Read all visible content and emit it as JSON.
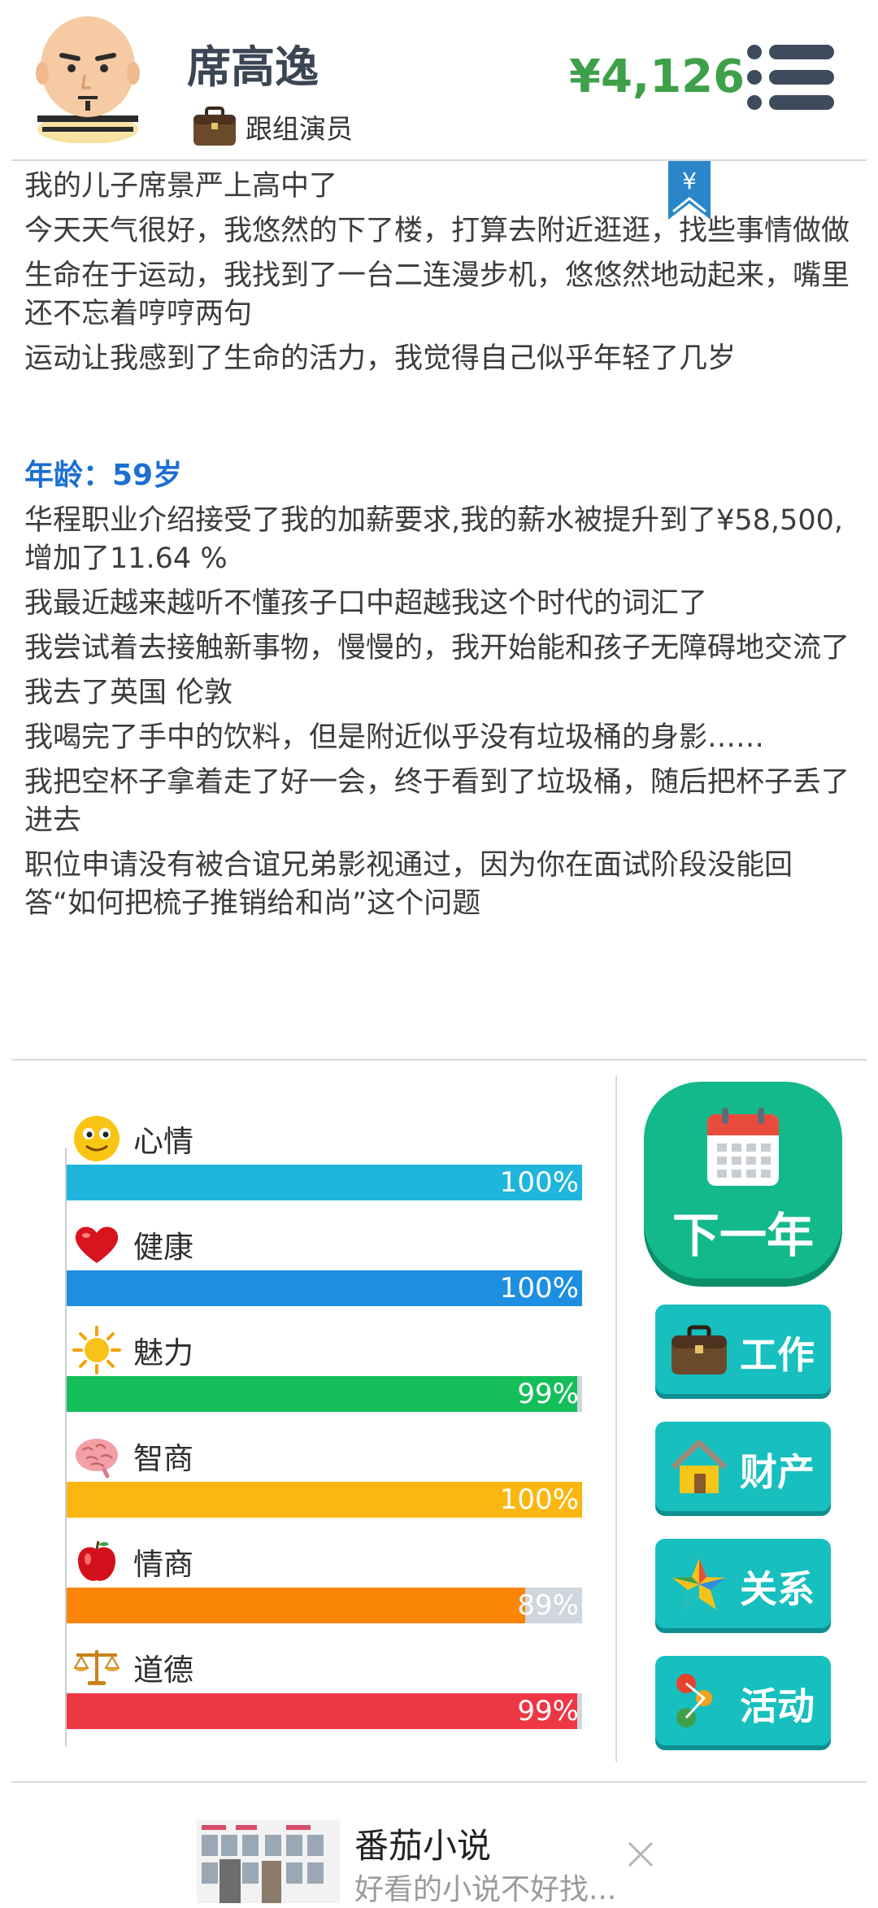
{
  "profile": {
    "name": "席高逸",
    "job": "跟组演员",
    "money": "¥4,126"
  },
  "bookmark": {
    "symbol": "¥"
  },
  "log": {
    "lines_before": [
      "我的儿子席景严上高中了",
      "今天天气很好，我悠然的下了楼，打算去附近逛逛，找些事情做做",
      "生命在于运动，我找到了一台二连漫步机，悠悠然地动起来，嘴里还不忘着哼哼两句",
      "运动让我感到了生命的活力，我觉得自己似乎年轻了几岁"
    ],
    "age_label": "年龄：59岁",
    "lines_after": [
      "华程职业介绍接受了我的加薪要求,我的薪水被提升到了¥58,500,增加了11.64 %",
      "我最近越来越听不懂孩子口中超越我这个时代的词汇了",
      "我尝试着去接触新事物，慢慢的，我开始能和孩子无障碍地交流了",
      "我去了英国 伦敦",
      "我喝完了手中的饮料，但是附近似乎没有垃圾桶的身影……",
      "我把空杯子拿着走了好一会，终于看到了垃圾桶，随后把杯子丢了进去",
      "职位申请没有被合谊兄弟影视通过，因为你在面试阶段没能回答“如何把梳子推销给和尚”这个问题"
    ]
  },
  "stats": [
    {
      "label": "心情",
      "icon": "smiley-icon",
      "value": 100,
      "text": "100%",
      "color": "#1fb5dd"
    },
    {
      "label": "健康",
      "icon": "heart-icon",
      "value": 100,
      "text": "100%",
      "color": "#1e8fe0"
    },
    {
      "label": "魅力",
      "icon": "sun-icon",
      "value": 99,
      "text": "99%",
      "color": "#14bf5a"
    },
    {
      "label": "智商",
      "icon": "brain-icon",
      "value": 100,
      "text": "100%",
      "color": "#fbb612"
    },
    {
      "label": "情商",
      "icon": "apple-icon",
      "value": 89,
      "text": "89%",
      "color": "#fb8605"
    },
    {
      "label": "道德",
      "icon": "scales-icon",
      "value": 99,
      "text": "99%",
      "color": "#ee3744"
    }
  ],
  "actions": {
    "next_year": "下一年",
    "work": "工作",
    "property": "财产",
    "relations": "关系",
    "activities": "活动"
  },
  "ad": {
    "title": "番茄小说",
    "subtitle": "好看的小说不好找..."
  }
}
